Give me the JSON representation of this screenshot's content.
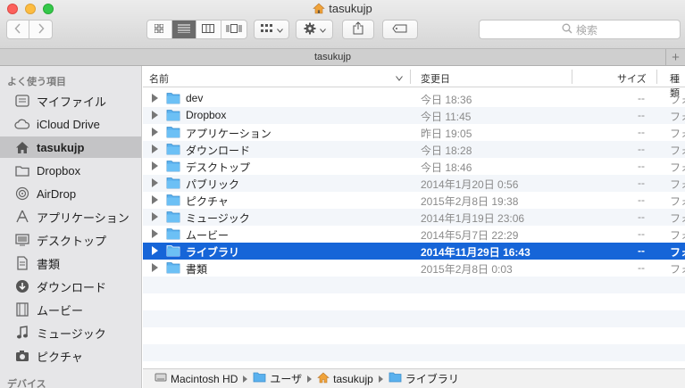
{
  "window": {
    "title": "tasukujp",
    "tab_title": "tasukujp",
    "search_placeholder": "検索"
  },
  "toolbar": {
    "view_modes": [
      "icon-view",
      "list-view",
      "column-view",
      "coverflow-view"
    ],
    "active_view": "list-view"
  },
  "sidebar": {
    "favorites_heading": "よく使う項目",
    "devices_heading": "デバイス",
    "items": [
      {
        "label": "マイファイル",
        "icon": "all-my-files-icon"
      },
      {
        "label": "iCloud Drive",
        "icon": "cloud-icon"
      },
      {
        "label": "tasukujp",
        "icon": "home-icon",
        "selected": true
      },
      {
        "label": "Dropbox",
        "icon": "folder-icon"
      },
      {
        "label": "AirDrop",
        "icon": "airdrop-icon"
      },
      {
        "label": "アプリケーション",
        "icon": "applications-icon"
      },
      {
        "label": "デスクトップ",
        "icon": "desktop-icon"
      },
      {
        "label": "書類",
        "icon": "documents-icon"
      },
      {
        "label": "ダウンロード",
        "icon": "download-icon"
      },
      {
        "label": "ムービー",
        "icon": "movies-icon"
      },
      {
        "label": "ミュージック",
        "icon": "music-icon"
      },
      {
        "label": "ピクチャ",
        "icon": "pictures-icon"
      }
    ]
  },
  "columns": {
    "name": "名前",
    "date": "変更日",
    "size": "サイズ",
    "kind": "種類"
  },
  "files": [
    {
      "name": "dev",
      "date": "今日 18:36",
      "size": "--",
      "kind": "フォ"
    },
    {
      "name": "Dropbox",
      "date": "今日 11:45",
      "size": "--",
      "kind": "フォ"
    },
    {
      "name": "アプリケーション",
      "date": "昨日 19:05",
      "size": "--",
      "kind": "フォ"
    },
    {
      "name": "ダウンロード",
      "date": "今日 18:28",
      "size": "--",
      "kind": "フォ"
    },
    {
      "name": "デスクトップ",
      "date": "今日 18:46",
      "size": "--",
      "kind": "フォ"
    },
    {
      "name": "パブリック",
      "date": "2014年1月20日 0:56",
      "size": "--",
      "kind": "フォ"
    },
    {
      "name": "ピクチャ",
      "date": "2015年2月8日 19:38",
      "size": "--",
      "kind": "フォ"
    },
    {
      "name": "ミュージック",
      "date": "2014年1月19日 23:06",
      "size": "--",
      "kind": "フォ"
    },
    {
      "name": "ムービー",
      "date": "2014年5月7日 22:29",
      "size": "--",
      "kind": "フォ"
    },
    {
      "name": "ライブラリ",
      "date": "2014年11月29日 16:43",
      "size": "--",
      "kind": "フォ",
      "selected": true
    },
    {
      "name": "書類",
      "date": "2015年2月8日 0:03",
      "size": "--",
      "kind": "フォ"
    }
  ],
  "path": [
    "Macintosh HD",
    "ユーザ",
    "tasukujp",
    "ライブラリ"
  ],
  "colors": {
    "selection": "#1665d8",
    "folder": "#5ab1ee",
    "sidebar_bg": "#e6e6e8"
  }
}
